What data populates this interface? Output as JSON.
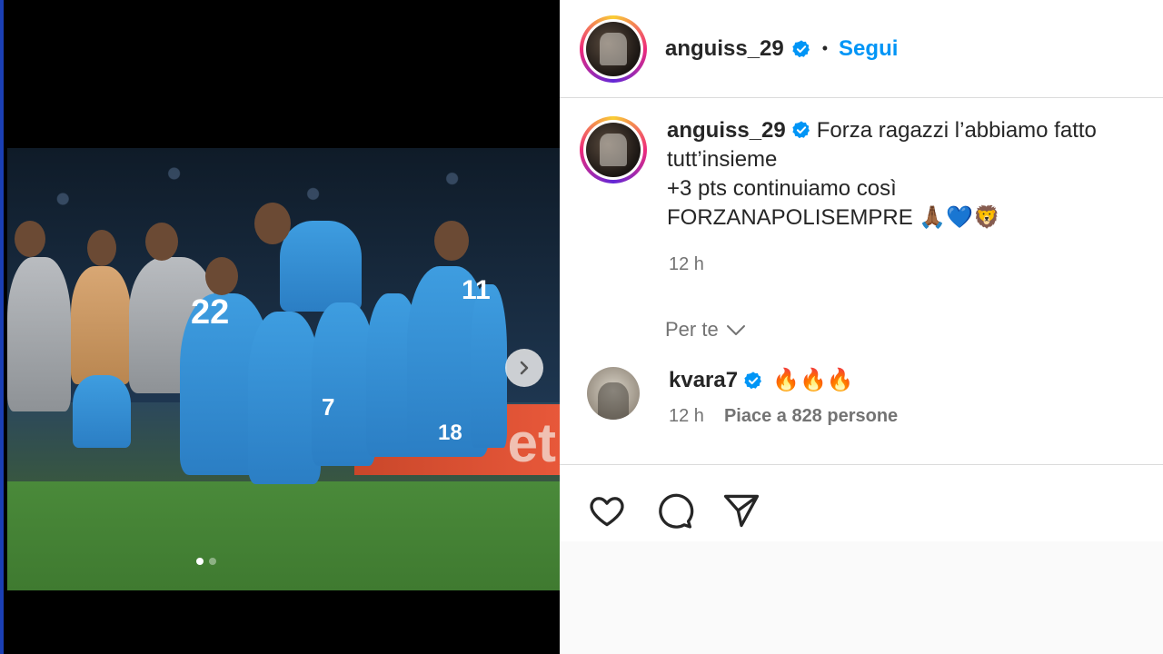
{
  "post": {
    "username": "anguiss_29",
    "separator": "•",
    "follow_label": "Segui",
    "caption_lines": [
      "Forza ragazzi l’abbiamo fatto",
      "tutt’insieme",
      "+3 pts continuiamo così",
      "FORZANAPOLISEMPRE 🙏🏾💙🦁"
    ],
    "time": "12 h",
    "sort_label": "Per te"
  },
  "comment": {
    "username": "kvara7",
    "text": "🔥🔥🔥",
    "time": "12 h",
    "likes": "Piace a 828 persone"
  },
  "media": {
    "jersey_numbers": [
      "22",
      "7",
      "18",
      "11"
    ],
    "carousel_total": 2,
    "carousel_index": 1,
    "ad_board_text": "et"
  },
  "colors": {
    "accent": "#0095f6",
    "verified": "#0095f6",
    "jersey": "#3e9de0"
  },
  "icons": {
    "like": "heart-icon",
    "comment": "comment-icon",
    "share": "send-icon",
    "next": "chevron-right-icon",
    "sort": "chevron-down-icon",
    "verified": "verified-badge-icon"
  }
}
